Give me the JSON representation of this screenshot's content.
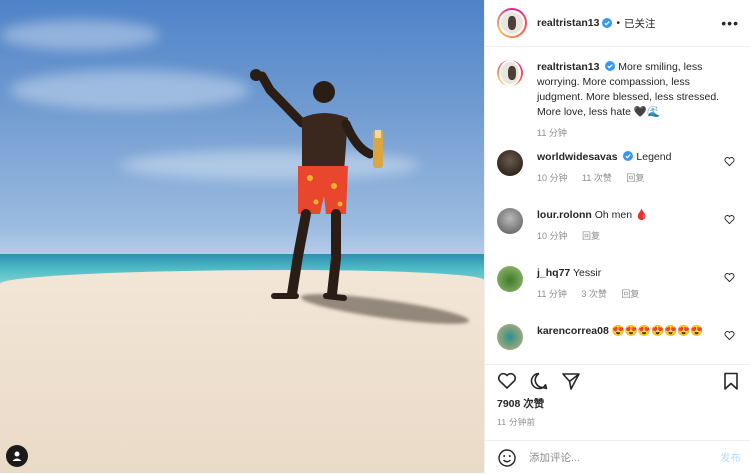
{
  "post_author": {
    "username": "realtristan13",
    "verified": true,
    "separator": "•",
    "follow_status": "已关注",
    "more_icon": "ellipsis-icon"
  },
  "caption": {
    "username": "realtristan13",
    "text": "More smiling, less worrying. More compassion, less judgment. More blessed, less stressed. More love, less hate 🖤🌊",
    "time": "11 分钟"
  },
  "comments": [
    {
      "username": "worldwidesavas",
      "verified": true,
      "text": "Legend",
      "time": "10 分钟",
      "likes": "11 次赞",
      "reply": "回复"
    },
    {
      "username": "lour.rolonn",
      "verified": false,
      "text": "Oh men 🩸",
      "time": "10 分钟",
      "likes": "",
      "reply": "回复"
    },
    {
      "username": "j_hq77",
      "verified": false,
      "text": "Yessir",
      "time": "11 分钟",
      "likes": "3 次赞",
      "reply": "回复"
    },
    {
      "username": "karencorrea08",
      "verified": false,
      "text": "😍😍😍😍😍😍😍",
      "time": "",
      "likes": "",
      "reply": ""
    }
  ],
  "stats": {
    "likes": "7908 次赞",
    "posted": "11 分钟前"
  },
  "comment_box": {
    "placeholder": "添加评论...",
    "post_label": "发布"
  },
  "colors": {
    "accent": "#0095f6",
    "verified": "#3897f0",
    "muted": "#8e8e8e"
  }
}
